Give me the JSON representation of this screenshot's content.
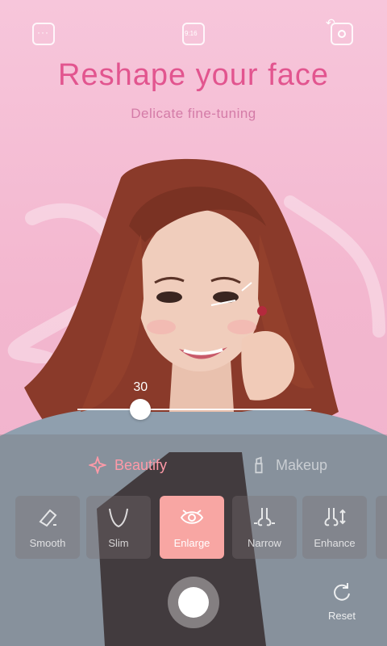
{
  "header": {
    "title": "Reshape your face",
    "subtitle": "Delicate fine-tuning",
    "ratio_label": "9:16"
  },
  "slider": {
    "value": "30",
    "fraction": 0.27
  },
  "tabs": [
    {
      "label": "Beautify",
      "active": true
    },
    {
      "label": "Makeup",
      "active": false
    }
  ],
  "tools": [
    {
      "label": "Smooth",
      "icon": "eraser-icon"
    },
    {
      "label": "Slim",
      "icon": "jaw-icon"
    },
    {
      "label": "Enlarge",
      "icon": "eye-icon",
      "active": true
    },
    {
      "label": "Narrow",
      "icon": "nose-narrow-icon"
    },
    {
      "label": "Enhance",
      "icon": "nose-enhance-icon"
    }
  ],
  "reset_label": "Reset",
  "colors": {
    "accent": "#e2558f",
    "active_tile": "#f8a6a3",
    "tab_active": "#ff9aa8"
  }
}
